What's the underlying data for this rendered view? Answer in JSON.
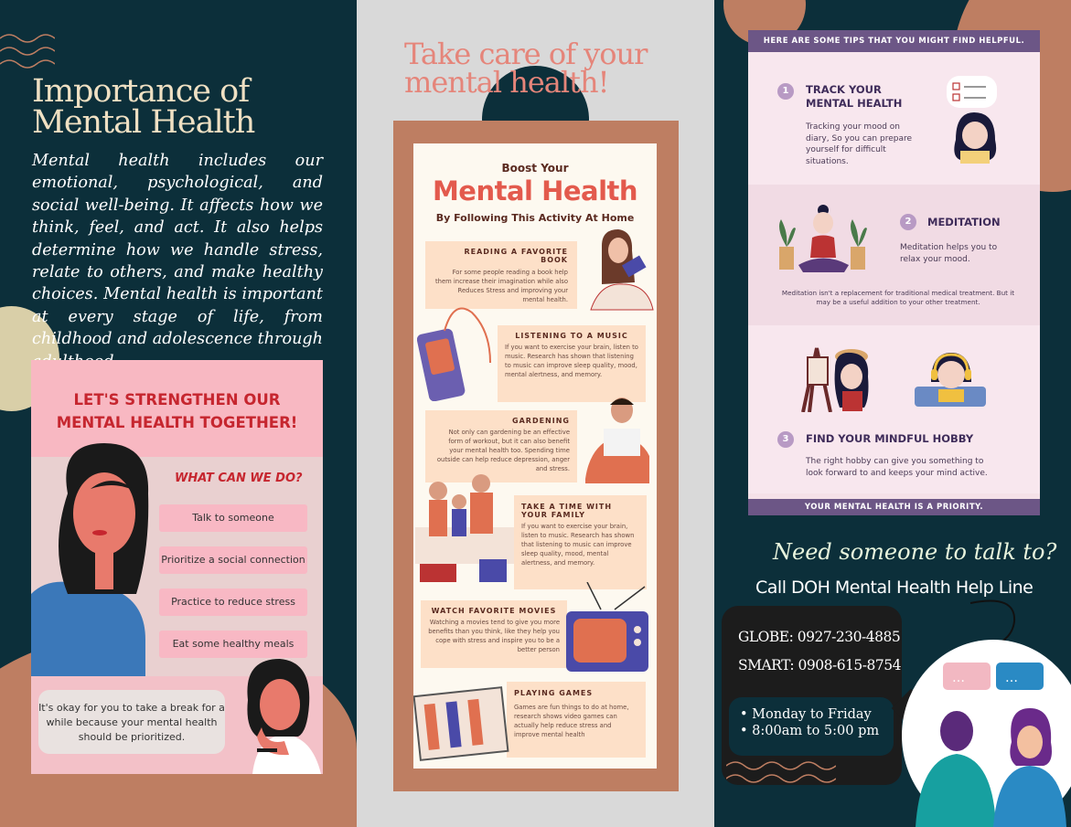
{
  "left": {
    "title_line1": "Importance of",
    "title_line2": "Mental Health",
    "intro": "Mental health includes our emotional, psychological, and social well-being. It affects how we think, feel, and act. It also helps determine how we handle stress, relate to others, and make healthy choices. Mental health is important at every stage of life, from childhood and adolescence through adulthood.",
    "card": {
      "heading_line1": "LET'S STRENGTHEN OUR",
      "heading_line2": "MENTAL HEALTH TOGETHER!",
      "question": "WHAT CAN WE DO?",
      "actions": [
        "Talk to someone",
        "Prioritize a social connection",
        "Practice to reduce stress",
        "Eat some healthy meals"
      ],
      "bubble": "It's okay for you to take a break for a while because your mental health should be prioritized."
    }
  },
  "middle": {
    "title_line1": "Take care of your",
    "title_line2": "mental health!",
    "poster": {
      "kicker": "Boost Your",
      "title": "Mental Health",
      "subtitle": "By Following This Activity At Home",
      "activities": [
        {
          "title": "READING A FAVORITE BOOK",
          "text": "For some people reading a book help them increase their imagination while also Reduces Stress and improving your mental health."
        },
        {
          "title": "LISTENING TO A MUSIC",
          "text": "If you want to exercise your brain, listen to music. Research has shown that listening to music can improve sleep quality, mood, mental alertness, and memory."
        },
        {
          "title": "GARDENING",
          "text": "Not only can gardening be an effective form of workout, but it can also benefit your mental health too. Spending time outside can help reduce depression, anger and stress."
        },
        {
          "title": "TAKE A TIME WITH YOUR FAMILY",
          "text": "If you want to exercise your brain, listen to music. Research has shown that listening to music can improve sleep quality, mood, mental alertness, and memory."
        },
        {
          "title": "WATCH FAVORITE MOVIES",
          "text": "Watching a movies tend to give you more benefits than you think, like they help you cope with stress and inspire you to be a better person"
        },
        {
          "title": "PLAYING GAMES",
          "text": "Games are fun things to do at home, research shows video games can actually help reduce stress and improve mental health"
        }
      ]
    }
  },
  "right": {
    "tips_header": "HERE ARE SOME TIPS THAT YOU MIGHT FIND HELPFUL.",
    "tips": [
      {
        "num": "1",
        "title_line1": "TRACK YOUR",
        "title_line2": "MENTAL HEALTH",
        "text": "Tracking your mood on diary, So you can prepare yourself for difficult situations."
      },
      {
        "num": "2",
        "title_line1": "MEDITATION",
        "title_line2": "",
        "text": "Meditation helps you to relax your mood."
      },
      {
        "num": "3",
        "title_line1": "FIND YOUR MINDFUL HOBBY",
        "title_line2": "",
        "text": "The right hobby can give you something to look forward to and keeps your mind active."
      }
    ],
    "note": "Meditation isn't a replacement for traditional medical treatment. But it may be a useful addition to your other treatment.",
    "tips_footer": "YOUR MENTAL HEALTH IS A PRIORITY.",
    "need": "Need someone to talk to?",
    "call": "Call DOH Mental Health Help Line",
    "globe": "GLOBE: 0927-230-4885",
    "smart": "SMART: 0908-615-8754",
    "days": "Monday to Friday",
    "time": "8:00am to 5:00 pm"
  },
  "colors": {
    "navy": "#0c2f3a",
    "rust": "#be7e62",
    "pink": "#f8b8c2",
    "purple": "#6c5686",
    "red": "#c6262f"
  }
}
